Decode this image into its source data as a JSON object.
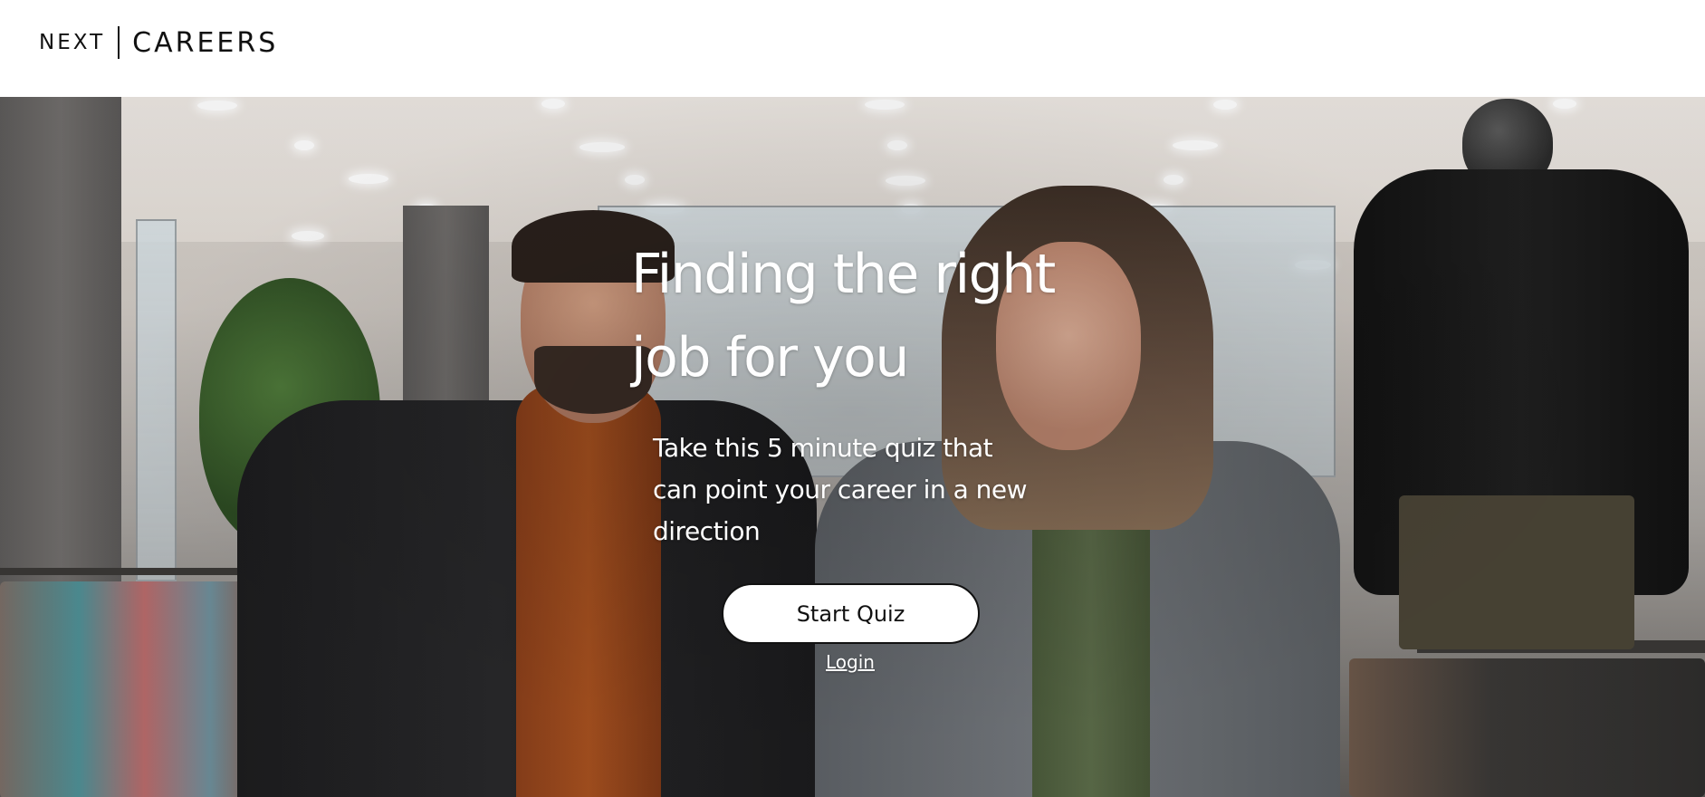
{
  "header": {
    "logo_primary": "NEXT",
    "logo_secondary": "CAREERS"
  },
  "hero": {
    "title_line_1": "Finding the right",
    "title_line_2": "job for you",
    "subtitle_line_1": "Take this 5 minute quiz that",
    "subtitle_line_2": "can point your career in a new",
    "subtitle_line_3": "direction",
    "start_button_label": "Start Quiz",
    "login_label": "Login",
    "background_image": "store-staff-photo"
  },
  "colors": {
    "header_bg": "#ffffff",
    "logo_text": "#111111",
    "hero_text": "#ffffff",
    "button_bg": "#ffffff",
    "button_border": "#111111"
  }
}
